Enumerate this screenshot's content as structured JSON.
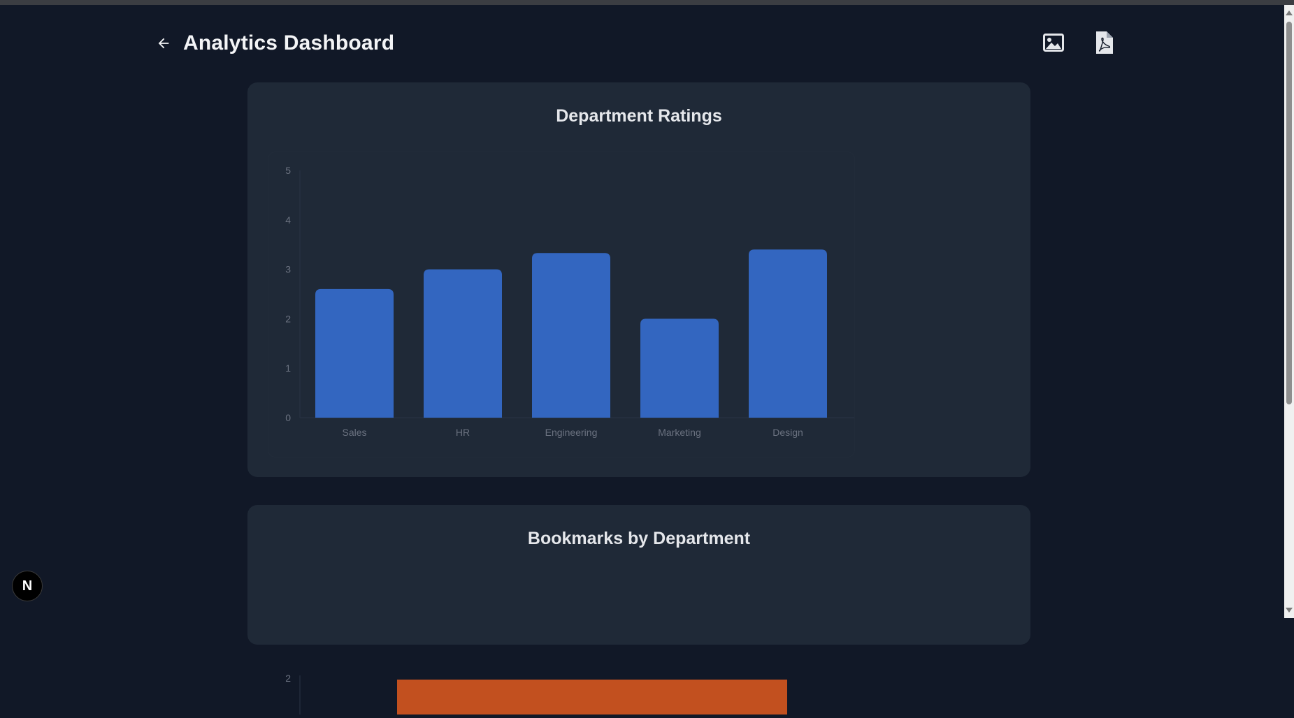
{
  "header": {
    "title": "Analytics Dashboard",
    "back_icon": "arrow-left-icon",
    "actions": [
      {
        "icon": "image-icon"
      },
      {
        "icon": "pdf-file-icon"
      }
    ]
  },
  "colors": {
    "background": "#111827",
    "card": "#1f2937",
    "bar_blue": "#3366c0",
    "bar_orange": "#c2501f",
    "axis_text": "#6b7280"
  },
  "badge": {
    "label": "N"
  },
  "chart_data": [
    {
      "type": "bar",
      "title": "Department Ratings",
      "categories": [
        "Sales",
        "HR",
        "Engineering",
        "Marketing",
        "Design"
      ],
      "values": [
        2.6,
        3.0,
        3.33,
        2.0,
        3.4
      ],
      "ylim": [
        0,
        5
      ],
      "yticks": [
        0,
        1,
        2,
        3,
        4,
        5
      ],
      "xlabel": "",
      "ylabel": "",
      "grid": false,
      "color": "#3366c0"
    },
    {
      "type": "bar",
      "title": "Bookmarks by Department",
      "yticks_visible": [
        2
      ],
      "ylim": [
        0,
        2
      ],
      "visible_bar": {
        "value": 2
      },
      "color": "#c2501f"
    }
  ]
}
